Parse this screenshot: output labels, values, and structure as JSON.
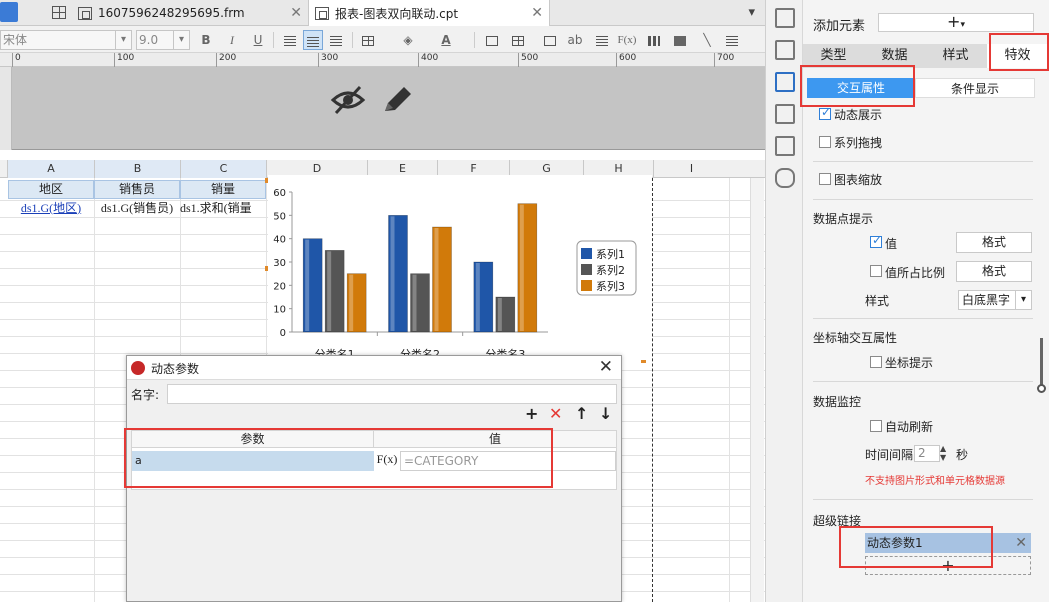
{
  "tabs": [
    {
      "title": "1607596248295695.frm"
    },
    {
      "title": "报表-图表双向联动.cpt"
    }
  ],
  "toolbar": {
    "font_name": "宋体",
    "font_size": "9.0",
    "bold": "B",
    "italic": "I",
    "underline": "U",
    "fx": "F(x)",
    "ab": "ab"
  },
  "ruler": {
    "ticks": [
      "0",
      "100",
      "200",
      "300",
      "400",
      "500",
      "600",
      "700"
    ]
  },
  "columns": [
    "A",
    "B",
    "C",
    "D",
    "E",
    "F",
    "G",
    "H",
    "I"
  ],
  "sheet": {
    "headers": [
      "地区",
      "销售员",
      "销量"
    ],
    "row2": [
      "ds1.G(地区)",
      "ds1.G(销售员)",
      "ds1.求和(销量"
    ]
  },
  "chart_data": {
    "type": "bar",
    "categories": [
      "分类名1",
      "分类名2",
      "分类名3"
    ],
    "series": [
      {
        "name": "系列1",
        "values": [
          40,
          50,
          30
        ],
        "color": "#1f56a8"
      },
      {
        "name": "系列2",
        "values": [
          35,
          25,
          15
        ],
        "color": "#555555"
      },
      {
        "name": "系列3",
        "values": [
          25,
          45,
          55
        ],
        "color": "#d17a0a"
      }
    ],
    "yticks": [
      "0",
      "10",
      "20",
      "30",
      "40",
      "50",
      "60"
    ],
    "ylim": [
      0,
      60
    ],
    "legend": "right"
  },
  "dialog": {
    "title": "动态参数",
    "name_label": "名字:",
    "name_value": "",
    "col_param": "参数",
    "col_value": "值",
    "rows": [
      {
        "param": "a",
        "fx": "F(x)",
        "value_placeholder": "=CATEGORY"
      }
    ],
    "actions": {
      "add": "+",
      "delete": "✕",
      "up": "↑",
      "down": "↓"
    },
    "close": "✕"
  },
  "panel": {
    "add_element_label": "添加元素",
    "add_symbol": "+",
    "tabs": [
      "类型",
      "数据",
      "样式",
      "特效"
    ],
    "subtabs": [
      "交互属性",
      "条件显示"
    ],
    "dynamic_show": "动态展示",
    "series_drag": "系列拖拽",
    "chart_zoom": "图表缩放",
    "tooltip_section": "数据点提示",
    "value_label": "值",
    "ratio_label": "值所占比例",
    "format_btn": "格式",
    "style_label": "样式",
    "style_value": "白底黑字",
    "axis_section": "坐标轴交互属性",
    "axis_tip": "坐标提示",
    "monitor_section": "数据监控",
    "auto_refresh": "自动刷新",
    "interval_label": "时间间隔",
    "interval_value": "2",
    "interval_unit": "秒",
    "warning": "不支持图片形式和单元格数据源",
    "hyperlink_section": "超级链接",
    "hyperlink_item": "动态参数1",
    "hyperlink_remove": "✕",
    "hyperlink_add": "+"
  },
  "colors": {
    "accent": "#3d98f0",
    "highlight": "#e53935"
  }
}
